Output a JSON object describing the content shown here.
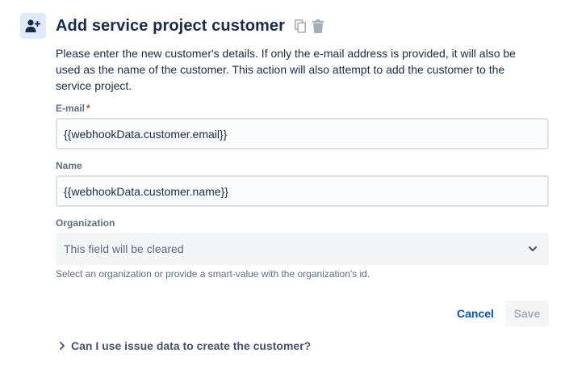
{
  "header": {
    "title": "Add service project customer",
    "icon": "add-user-icon",
    "actions": [
      "copy-icon",
      "trash-icon"
    ]
  },
  "description": "Please enter the new customer's details. If only the e-mail address is provided, it will also be used as the name of the customer. This action will also attempt to add the customer to the service project.",
  "form": {
    "email": {
      "label": "E-mail",
      "required_marker": "*",
      "value": "{{webhookData.customer.email}}"
    },
    "name": {
      "label": "Name",
      "value": "{{webhookData.customer.name}}"
    },
    "organization": {
      "label": "Organization",
      "value": "This field will be cleared",
      "helper": "Select an organization or provide a smart-value with the organization's id."
    }
  },
  "buttons": {
    "cancel": "Cancel",
    "save": "Save"
  },
  "faq": {
    "question": "Can I use issue data to create the customer?"
  },
  "colors": {
    "accent": "#0052cc",
    "icon_bg": "#deebff",
    "required": "#de350b"
  }
}
